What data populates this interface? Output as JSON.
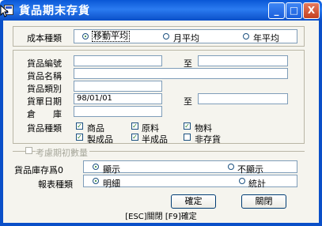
{
  "window": {
    "title": "貨品期末存貨",
    "controls": {
      "minimize": "_",
      "maximize": "□",
      "close": "X"
    }
  },
  "cost_type": {
    "label": "成本種類",
    "options": [
      {
        "label": "移動平均",
        "selected": true
      },
      {
        "label": "月平均",
        "selected": false
      },
      {
        "label": "年平均",
        "selected": false
      }
    ]
  },
  "filters": {
    "item_no_label": "貨品編號",
    "item_no_from": "",
    "to_label": "至",
    "item_no_to": "",
    "item_name_label": "貨品名稱",
    "item_name": "",
    "item_category_label": "貨品類別",
    "item_category": "",
    "doc_date_label": "貨單日期",
    "doc_date_from": "98/01/01",
    "doc_date_to": "",
    "warehouse_label": "倉　　庫",
    "warehouse": "",
    "item_type_label": "貨品種類",
    "item_types": [
      {
        "label": "商品",
        "checked": true
      },
      {
        "label": "原料",
        "checked": true
      },
      {
        "label": "物料",
        "checked": true
      },
      {
        "label": "製成品",
        "checked": true
      },
      {
        "label": "半成品",
        "checked": true
      },
      {
        "label": "非存貨",
        "checked": false
      }
    ]
  },
  "initial_qty": {
    "label": "考慮期初數量",
    "checked": false
  },
  "zero_stock": {
    "label": "貨品庫存爲0",
    "options": [
      {
        "label": "顯示",
        "selected": true
      },
      {
        "label": "不顯示",
        "selected": false
      }
    ]
  },
  "report_type": {
    "label": "報表種類",
    "options": [
      {
        "label": "明細",
        "selected": true
      },
      {
        "label": "統計",
        "selected": false
      }
    ]
  },
  "buttons": {
    "confirm": "確定",
    "close": "關閉"
  },
  "status_bar": "[ESC]關閉 [F9]確定",
  "colors": {
    "titlebar": "#0a57d6",
    "client": "#f5f4ee",
    "check": "#1e7a1e"
  }
}
